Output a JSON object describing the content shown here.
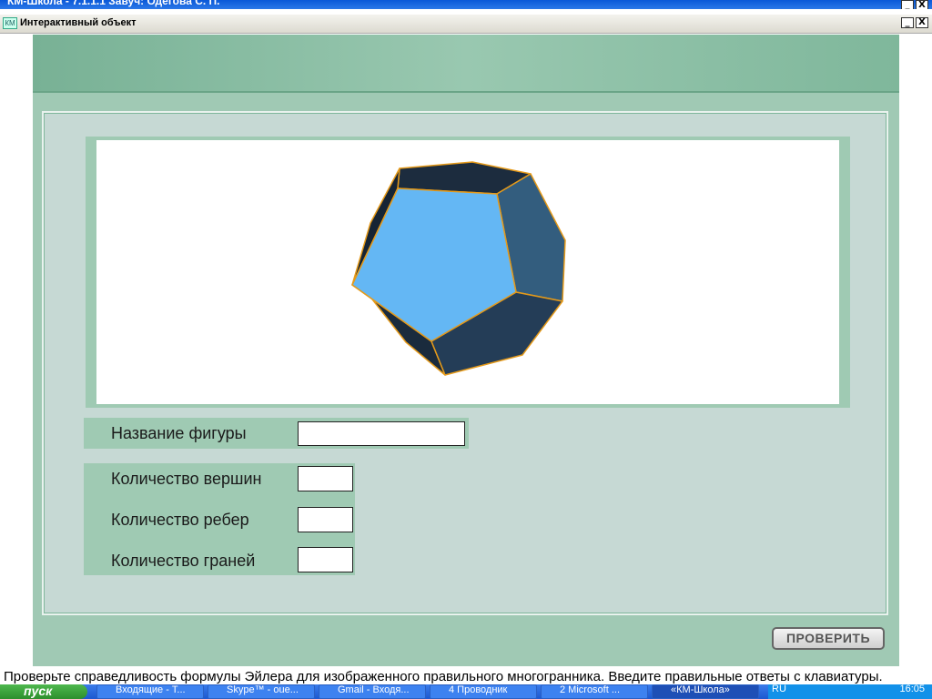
{
  "outer_window": {
    "title": "КМ-Школа - 7.1.1.1 Завуч: Одегова С. П.",
    "minimize": "_",
    "close": "X"
  },
  "window": {
    "icon_text": "КМ",
    "title": "Интерактивный объект",
    "minimize": "_",
    "close": "X"
  },
  "form": {
    "figure_name_label": "Название фигуры",
    "figure_name_value": "",
    "vertices_label": "Количество вершин",
    "vertices_value": "",
    "edges_label": "Количество ребер",
    "edges_value": "",
    "faces_label": "Количество граней",
    "faces_value": ""
  },
  "check_button": "ПРОВЕРИТЬ",
  "instruction": "Проверьте справедливость формулы Эйлера для изображенного правильного многогранника.  Введите правильные ответы с клавиатуры.",
  "taskbar": {
    "start": "пуск",
    "tasks": [
      {
        "label": "Входящие - T..."
      },
      {
        "label": "Skype™ - oue..."
      },
      {
        "label": "Gmail - Входя..."
      },
      {
        "label": "4 Проводник"
      },
      {
        "label": "2 Microsoft ..."
      },
      {
        "label": "«КМ-Школа»"
      }
    ],
    "lang": "RU",
    "clock": "16:05"
  },
  "colors": {
    "panel_bg": "#c6d9d4",
    "frame_green": "#9fcab3",
    "face_front": "#64b7f4",
    "face_dark": "#243b55",
    "edge_orange": "#e59a1a"
  }
}
